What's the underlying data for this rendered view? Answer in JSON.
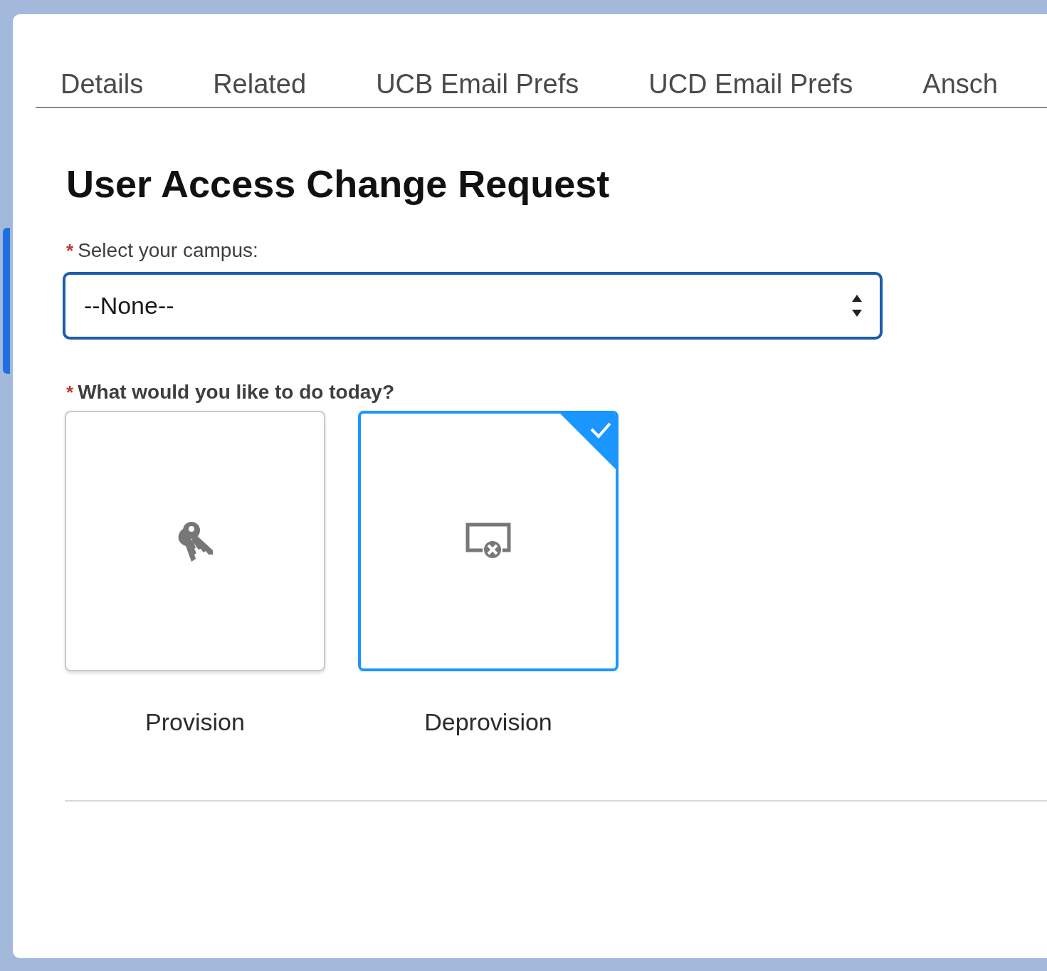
{
  "tabs": [
    {
      "label": "Details",
      "selected": false
    },
    {
      "label": "Related",
      "selected": false
    },
    {
      "label": "UCB Email Prefs",
      "selected": false
    },
    {
      "label": "UCD Email Prefs",
      "selected": false
    },
    {
      "label": "Ansch",
      "selected": false
    }
  ],
  "title": "User Access Change Request",
  "campus_field": {
    "required_mark": "*",
    "label": "Select your campus:",
    "value": "--None--"
  },
  "action_question": {
    "required_mark": "*",
    "label": "What would you like to do today?"
  },
  "actions": [
    {
      "kind": "keys",
      "label": "Provision",
      "selected": false
    },
    {
      "kind": "display-remove",
      "label": "Deprovision",
      "selected": true
    }
  ]
}
